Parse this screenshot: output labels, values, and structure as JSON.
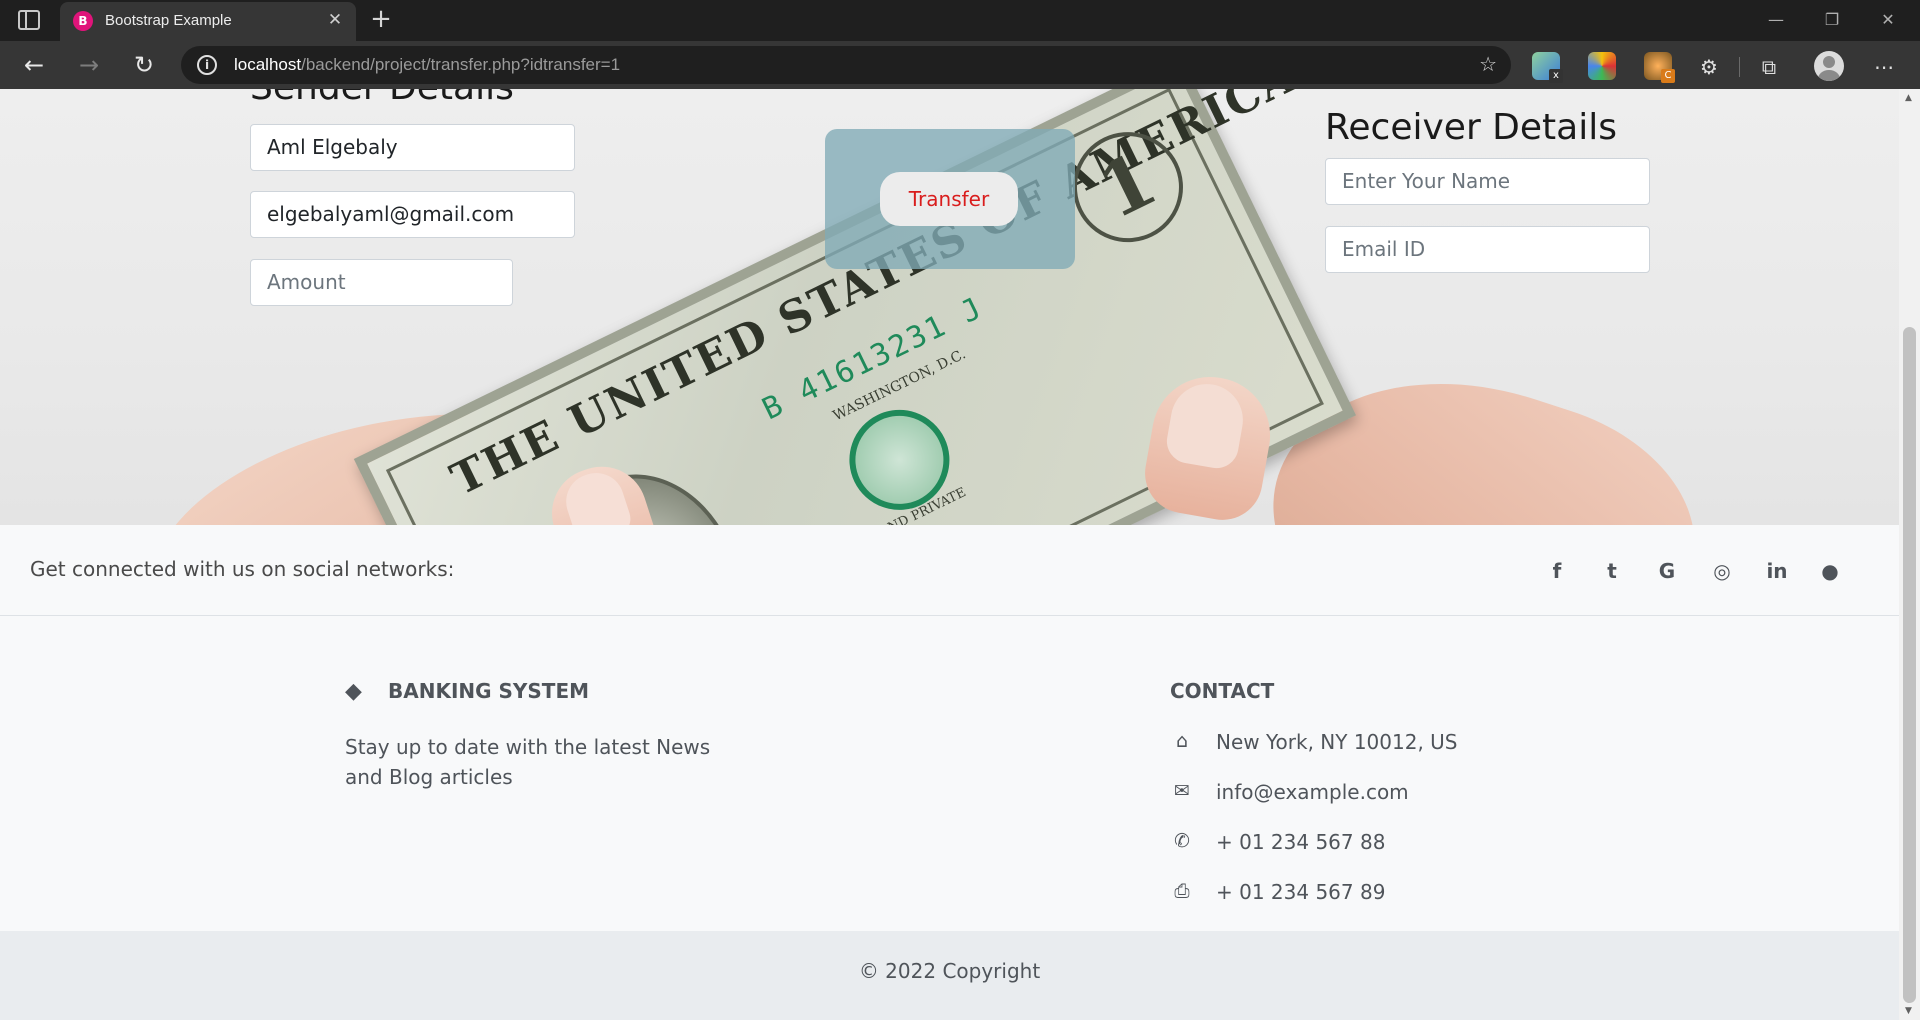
{
  "browser": {
    "tab_title": "Bootstrap Example",
    "tab_favicon": "bootstrap-icon",
    "tab_close": "✕",
    "new_tab": "+",
    "window_controls": {
      "minimize": "—",
      "restore": "❐",
      "close": "✕"
    },
    "nav": {
      "back": "←",
      "forward": "→",
      "reload": "↻"
    },
    "url_host": "localhost",
    "url_path": "/backend/project/transfer.php?idtransfer=1",
    "favorite_icon": "☆",
    "extensions": [
      "x-extension-icon",
      "color-picker-extension-icon",
      "c-extension-icon"
    ],
    "toolbar_icons": {
      "extensions": "⚙",
      "collections": "⧉",
      "menu": "⋯"
    }
  },
  "sender": {
    "title": "Sender Details",
    "name_value": "Aml Elgebaly",
    "email_value": "elgebalyaml@gmail.com",
    "amount_placeholder": "Amount"
  },
  "transfer": {
    "button_label": "Transfer"
  },
  "receiver": {
    "title": "Receiver Details",
    "name_placeholder": "Enter Your Name",
    "email_placeholder": "Email ID"
  },
  "hero_image": {
    "bill_text": "THE UNITED STATES OF AMERICA",
    "bill_serial": "B 41613231 J",
    "bill_legal": "THIS NOTE IS LEGAL TENDER FOR ALL DEBTS, PUBLIC AND PRIVATE",
    "bill_city": "WASHINGTON, D.C.",
    "bill_denomination": "1"
  },
  "social": {
    "text": "Get connected with us on social networks:",
    "icons": [
      {
        "name": "facebook-icon",
        "glyph": "f"
      },
      {
        "name": "twitter-icon",
        "glyph": "t"
      },
      {
        "name": "google-icon",
        "glyph": "G"
      },
      {
        "name": "instagram-icon",
        "glyph": "◎"
      },
      {
        "name": "linkedin-icon",
        "glyph": "in"
      },
      {
        "name": "github-icon",
        "glyph": "●"
      }
    ]
  },
  "footer": {
    "brand_title": "BANKING SYSTEM",
    "brand_description": "Stay up to date with the latest News and Blog articles",
    "contact_title": "CONTACT",
    "contact_items": [
      {
        "icon": "home-icon",
        "glyph": "⌂",
        "text": "New York, NY 10012, US"
      },
      {
        "icon": "envelope-icon",
        "glyph": "✉",
        "text": "info@example.com"
      },
      {
        "icon": "phone-icon",
        "glyph": "✆",
        "text": "+ 01 234 567 88"
      },
      {
        "icon": "print-icon",
        "glyph": "⎙",
        "text": "+ 01 234 567 89"
      }
    ],
    "copyright": "© 2022 Copyright"
  },
  "colors": {
    "transfer_text": "#d91d1d",
    "transfer_panel": "#80aab6",
    "footer_bg": "#f8f9fa",
    "copyright_bg": "#e9ecef",
    "text_muted": "#4f545a"
  }
}
